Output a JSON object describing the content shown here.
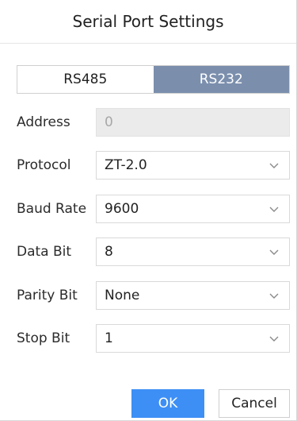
{
  "dialog": {
    "title": "Serial Port Settings"
  },
  "interface_tabs": {
    "options": [
      "RS485",
      "RS232"
    ],
    "selected": "RS232"
  },
  "fields": {
    "address": {
      "label": "Address",
      "placeholder": "0"
    },
    "protocol": {
      "label": "Protocol",
      "value": "ZT-2.0"
    },
    "baud_rate": {
      "label": "Baud Rate",
      "value": "9600"
    },
    "data_bit": {
      "label": "Data Bit",
      "value": "8"
    },
    "parity_bit": {
      "label": "Parity Bit",
      "value": "None"
    },
    "stop_bit": {
      "label": "Stop Bit",
      "value": "1"
    }
  },
  "buttons": {
    "ok": "OK",
    "cancel": "Cancel"
  },
  "colors": {
    "selected_tab": "#7b8fad",
    "primary_button": "#3d8ff5",
    "disabled_field": "#ebebeb"
  },
  "icons": {
    "dropdown": "chevron-down-icon"
  }
}
